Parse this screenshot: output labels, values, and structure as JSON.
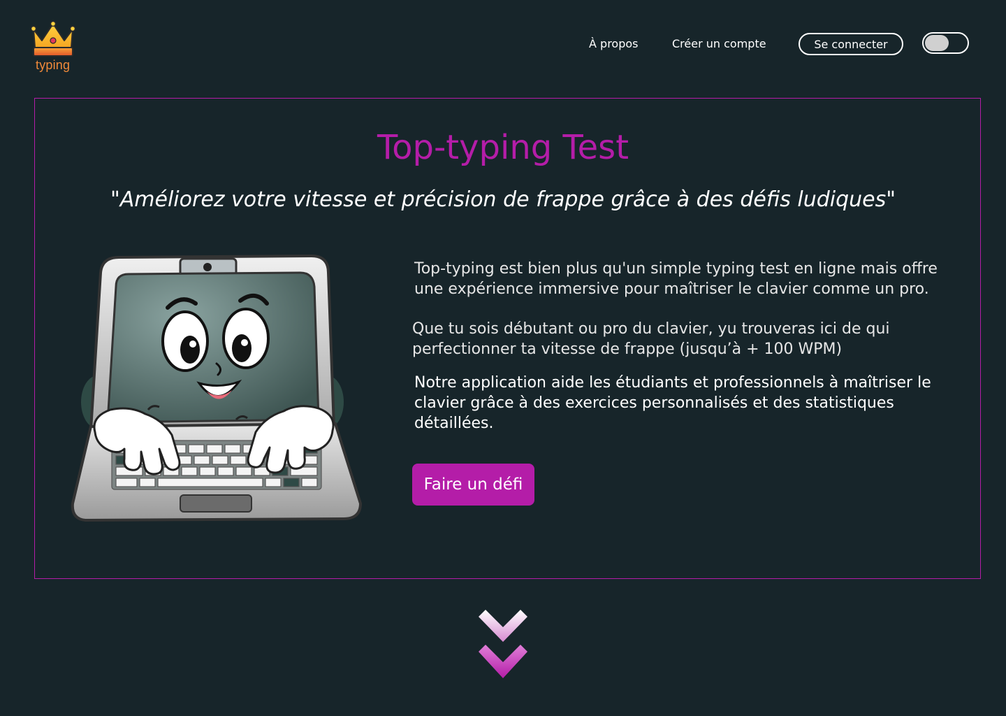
{
  "header": {
    "logo_text": "typing",
    "nav": {
      "about": "À propos",
      "signup": "Créer un compte",
      "login": "Se connecter"
    },
    "theme_toggle": {
      "on": false
    }
  },
  "hero": {
    "title": "Top-typing Test",
    "subtitle": "\"Améliorez votre vitesse et précision de frappe grâce à des défis ludiques\"",
    "paragraphs": [
      "Top-typing est bien plus qu'un simple typing test en ligne mais offre une expérience immersive pour maîtriser le clavier comme un pro.",
      "Que tu sois débutant ou pro du clavier, yu trouveras ici de qui perfectionner ta vitesse de frappe (jusqu’à + 100 WPM)",
      "Notre application aide les étudiants et professionnels à maîtriser le clavier grâce à des exercices personnalisés et des statistiques détaillées."
    ],
    "cta_label": "Faire un défi"
  },
  "colors": {
    "background": "#17252a",
    "accent": "#b41da8",
    "logo_text": "#f08a3a"
  },
  "icons": {
    "logo": "crown-icon",
    "scroll": "double-chevron-down-icon",
    "illustration": "laptop-mascot-illustration"
  }
}
